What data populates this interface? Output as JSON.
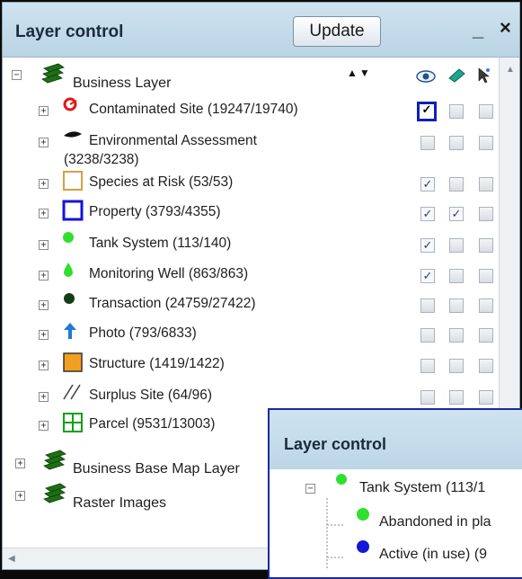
{
  "window": {
    "title": "Layer control",
    "update_label": "Update",
    "minimize_label": "_",
    "close_label": "×"
  },
  "colors": {
    "titlebar": "#c4dbea",
    "focus_border": "#1020b8",
    "brand_green": "#1e6e16"
  },
  "column_icons": [
    "visibility-icon",
    "label-icon",
    "select-icon"
  ],
  "sort_arrows": "▲▼",
  "tree": {
    "root_label": "Business Layer",
    "items": [
      {
        "label": "Contaminated Site (19247/19740)",
        "icon": "contaminated-site-icon",
        "checks": [
          true,
          false,
          false
        ]
      },
      {
        "label": "Environmental Assessment",
        "label2": "(3238/3238)",
        "icon": "environmental-assessment-icon",
        "checks": [
          false,
          false,
          false
        ]
      },
      {
        "label": "Species at Risk (53/53)",
        "icon": "species-at-risk-icon",
        "checks": [
          true,
          false,
          false
        ]
      },
      {
        "label": "Property (3793/4355)",
        "icon": "property-icon",
        "checks": [
          true,
          true,
          false
        ]
      },
      {
        "label": "Tank System (113/140)",
        "icon": "tank-system-icon",
        "checks": [
          true,
          false,
          false
        ]
      },
      {
        "label": "Monitoring Well (863/863)",
        "icon": "monitoring-well-icon",
        "checks": [
          true,
          false,
          false
        ]
      },
      {
        "label": "Transaction (24759/27422)",
        "icon": "transaction-icon",
        "checks": [
          false,
          false,
          false
        ]
      },
      {
        "label": "Photo (793/6833)",
        "icon": "photo-icon",
        "checks": [
          false,
          false,
          false
        ]
      },
      {
        "label": "Structure (1419/1422)",
        "icon": "structure-icon",
        "checks": [
          false,
          false,
          false
        ]
      },
      {
        "label": "Surplus Site (64/96)",
        "icon": "surplus-site-icon",
        "checks": [
          false,
          false,
          false
        ]
      },
      {
        "label": "Parcel (9531/13003)",
        "icon": "parcel-icon",
        "checks": [
          false,
          false,
          false
        ]
      }
    ],
    "other_groups": [
      "Business Base Map Layer",
      "Raster Images"
    ]
  },
  "overlay": {
    "title": "Layer control",
    "tank_label": "Tank System (113/1",
    "children": [
      "Abandoned in pla",
      "Active (in use) (9"
    ]
  }
}
